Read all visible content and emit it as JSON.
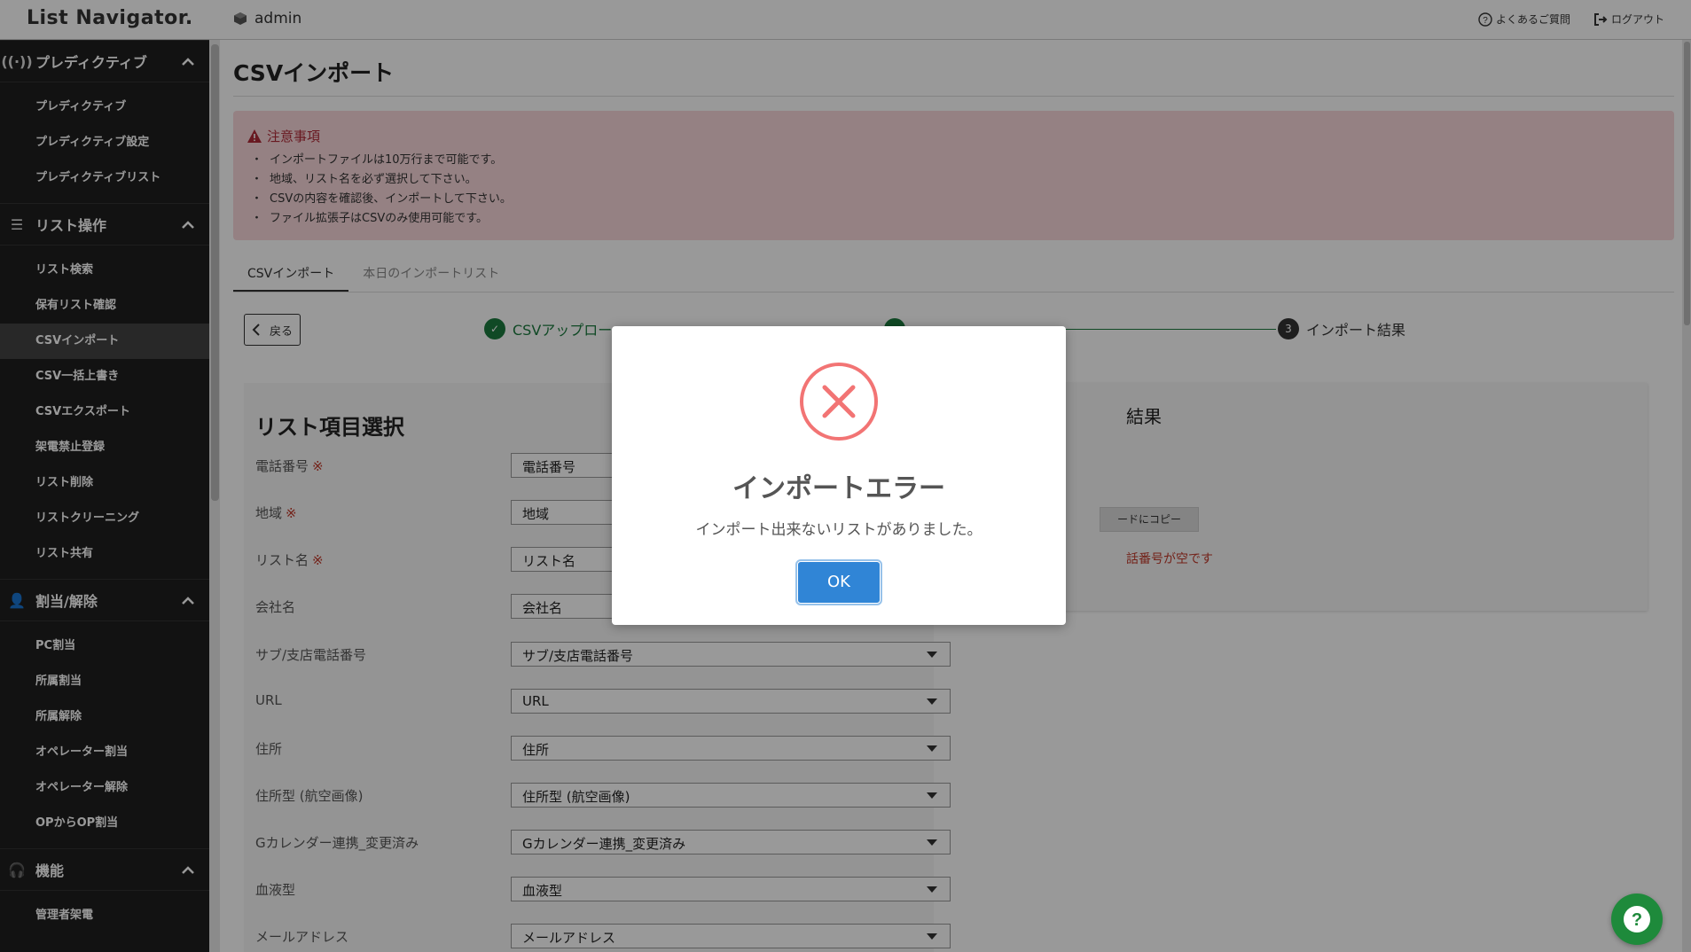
{
  "header": {
    "logo": "List Navigator.",
    "user": "admin",
    "faq": "よくあるご質問",
    "logout": "ログアウト"
  },
  "sidebar": {
    "sections": [
      {
        "title": "プレディクティブ",
        "icon": "broadcast-icon",
        "items": [
          "プレディクティブ",
          "プレディクティブ設定",
          "プレディクティブリスト"
        ]
      },
      {
        "title": "リスト操作",
        "icon": "list-icon",
        "items": [
          "リスト検索",
          "保有リスト確認",
          "CSVインポート",
          "CSV一括上書き",
          "CSVエクスポート",
          "架電禁止登録",
          "リスト削除",
          "リストクリーニング",
          "リスト共有"
        ]
      },
      {
        "title": "割当/解除",
        "icon": "user-check-icon",
        "items": [
          "PC割当",
          "所属割当",
          "所属解除",
          "オペレーター割当",
          "オペレーター解除",
          "OPからOP割当"
        ]
      },
      {
        "title": "機能",
        "icon": "headset-icon",
        "items": [
          "管理者架電"
        ]
      }
    ],
    "active_item": "CSVインポート"
  },
  "page": {
    "title": "CSVインポート",
    "notice": {
      "title": "注意事項",
      "items": [
        "インポートファイルは10万行まで可能です。",
        "地域、リスト名を必ず選択して下さい。",
        "CSVの内容を確認後、インポートして下さい。",
        "ファイル拡張子はCSVのみ使用可能です。"
      ]
    },
    "tabs": [
      "CSVインポート",
      "本日のインポートリスト"
    ],
    "back": "戻る",
    "steps": [
      {
        "num": "✓",
        "label": "CSVアップロー"
      },
      {
        "num": "",
        "label": ""
      },
      {
        "num": "3",
        "label": "インポート結果"
      }
    ],
    "form_title": "リスト項目選択",
    "required_mark": "※",
    "fields": [
      {
        "label": "電話番号",
        "value": "電話番号",
        "required": true
      },
      {
        "label": "地域",
        "value": "地域",
        "required": true
      },
      {
        "label": "リスト名",
        "value": "リスト名",
        "required": true
      },
      {
        "label": "会社名",
        "value": "会社名",
        "required": false
      },
      {
        "label": "サブ/支店電話番号",
        "value": "サブ/支店電話番号",
        "required": false
      },
      {
        "label": "URL",
        "value": "URL",
        "required": false
      },
      {
        "label": "住所",
        "value": "住所",
        "required": false
      },
      {
        "label": "住所型 (航空画像)",
        "value": "住所型 (航空画像)",
        "required": false
      },
      {
        "label": "Gカレンダー連携_変更済み",
        "value": "Gカレンダー連携_変更済み",
        "required": false
      },
      {
        "label": "血液型",
        "value": "血液型",
        "required": false
      },
      {
        "label": "メールアドレス",
        "value": "メールアドレス",
        "required": false
      }
    ],
    "result": {
      "title_fragment": "結果",
      "copy_fragment": "ードにコピー",
      "error_fragment": "話番号が空です"
    }
  },
  "modal": {
    "title": "インポートエラー",
    "message": "インポート出来ないリストがありました。",
    "ok": "OK"
  },
  "colors": {
    "accent_green": "#1b7a3e",
    "error_red": "#c0392b",
    "ok_blue": "#3085d6",
    "sidebar_bg": "#1f1f1f"
  }
}
